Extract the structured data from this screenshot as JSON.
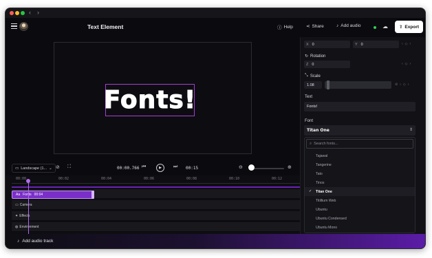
{
  "window": {
    "nav_back": "‹",
    "nav_forward": "›"
  },
  "header": {
    "title": "Text Element",
    "help_label": "Help",
    "share_label": "Share",
    "add_audio_label": "Add audio",
    "export_label": "Export"
  },
  "canvas": {
    "text": "Fonts!"
  },
  "controls": {
    "aspect_label": "Landscape (1...",
    "current_time": "00:00.766",
    "end_time": "00:15"
  },
  "timeline": {
    "ticks": [
      "00:00",
      "00:02",
      "00:04",
      "00:06",
      "00:08",
      "00:10",
      "00:12"
    ],
    "tracks": [
      {
        "icon": "Aa",
        "name": "Fonts",
        "clip_time": "00:04"
      },
      {
        "icon": "▭",
        "name": "Camera"
      },
      {
        "icon": "✦",
        "name": "Effects"
      },
      {
        "icon": "◍",
        "name": "Environment"
      }
    ],
    "add_audio_track": "Add audio track"
  },
  "panel": {
    "x_label": "X",
    "x_value": "0",
    "y_label": "Y",
    "y_value": "0",
    "rotation_label": "Rotation",
    "z_label": "Z",
    "z_value": "0",
    "scale_label": "Scale",
    "scale_value": "1.08",
    "text_label": "Text",
    "text_value": "Fonts!",
    "font_label": "Font",
    "font_value": "Titan One",
    "search_placeholder": "Search fonts...",
    "font_options": [
      "Tajawal",
      "Tangerine",
      "Tato",
      "Tinos",
      "Titan One",
      "Titillium Web",
      "Ubuntu",
      "Ubuntu Condensed",
      "Ubuntu Mono"
    ],
    "selected_font_index": 4
  }
}
